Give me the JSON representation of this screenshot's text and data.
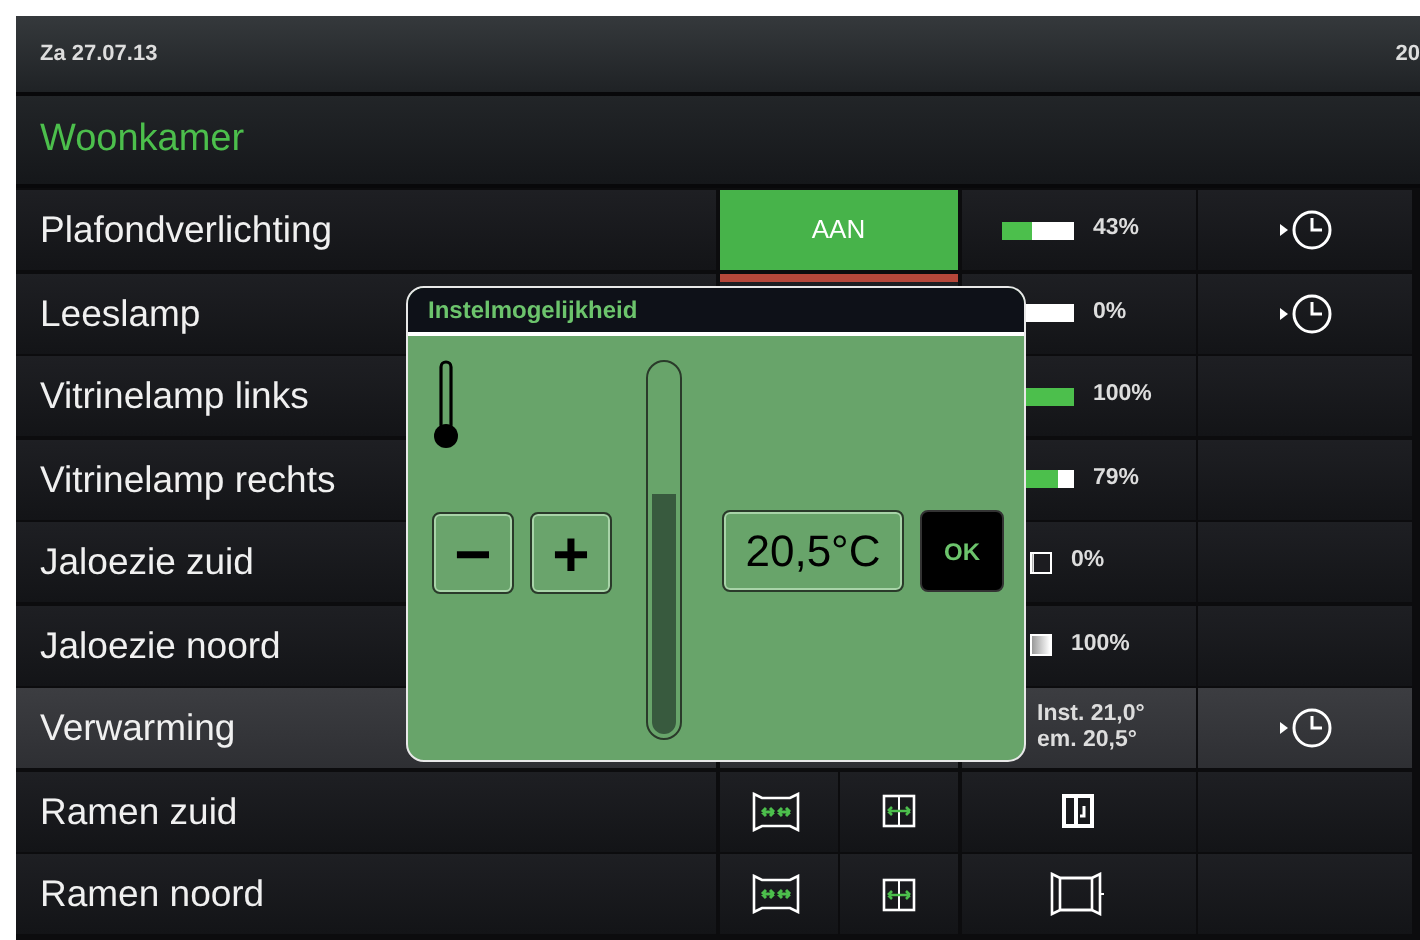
{
  "header": {
    "date": "Za 27.07.13",
    "time": "20"
  },
  "room": {
    "title": "Woonkamer"
  },
  "rows": [
    {
      "label": "Plafondverlichting",
      "kind": "dimmer",
      "selected": false,
      "button": {
        "label": "AAN",
        "on": true
      },
      "level": 0.43,
      "reading": "43%",
      "timer": true
    },
    {
      "label": "Leeslamp",
      "kind": "dimmer",
      "selected": false,
      "button": {
        "on": false
      },
      "level": 0,
      "reading": "0%",
      "timer": true
    },
    {
      "label": "Vitrinelamp links",
      "kind": "dimmer",
      "selected": false,
      "level": 1,
      "reading": "100%",
      "timer": false
    },
    {
      "label": "Vitrinelamp rechts",
      "kind": "dimmer",
      "selected": false,
      "level": 0.79,
      "reading": "79%",
      "timer": false
    },
    {
      "label": "Jaloezie zuid",
      "kind": "blind",
      "selected": false,
      "level": 0,
      "reading": "0%",
      "timer": false
    },
    {
      "label": "Jaloezie noord",
      "kind": "blind",
      "selected": false,
      "level": 1,
      "reading": "100%",
      "timer": false
    },
    {
      "label": "Verwarming",
      "kind": "heating",
      "selected": true,
      "readings": [
        "Inst. 21,0°",
        "em. 20,5°"
      ],
      "timer": true
    },
    {
      "label": "Ramen zuid",
      "kind": "window",
      "selected": false,
      "door": true,
      "timer": false
    },
    {
      "label": "Ramen noord",
      "kind": "window",
      "selected": false,
      "door": false,
      "timer": false
    }
  ],
  "dialog": {
    "title": "Instelmogelijkheid",
    "minus": "−",
    "plus": "+",
    "level": 0.65,
    "value": "20,5°C",
    "ok": "OK"
  }
}
